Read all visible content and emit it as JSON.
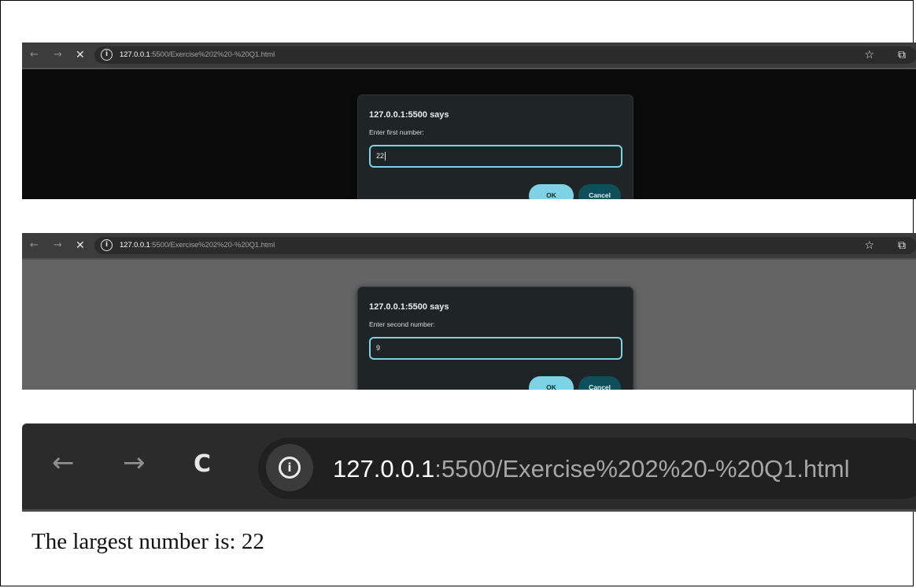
{
  "shots": [
    {
      "url_host": "127.0.0.1",
      "url_rest": ":5500/Exercise%202%20-%20Q1.html",
      "dialog": {
        "title": "127.0.0.1:5500 says",
        "message": "Enter first number:",
        "input_value": "22",
        "ok_label": "OK",
        "cancel_label": "Cancel"
      }
    },
    {
      "url_host": "127.0.0.1",
      "url_rest": ":5500/Exercise%202%20-%20Q1.html",
      "dialog": {
        "title": "127.0.0.1:5500 says",
        "message": "Enter second number:",
        "input_value": "9",
        "ok_label": "OK",
        "cancel_label": "Cancel"
      }
    }
  ],
  "result_browser": {
    "url_host": "127.0.0.1",
    "url_rest": ":5500/Exercise%202%20-%20Q1.html"
  },
  "result_text": "The largest number is: 22",
  "icons": {
    "back": "←",
    "forward": "→",
    "stop": "✕",
    "reload": "C",
    "info": "i",
    "star": "☆",
    "extensions": "⧉"
  },
  "colors": {
    "dialog_bg": "#1f2426",
    "accent": "#7dd3e5",
    "cancel_bg": "#0f4f5c"
  }
}
